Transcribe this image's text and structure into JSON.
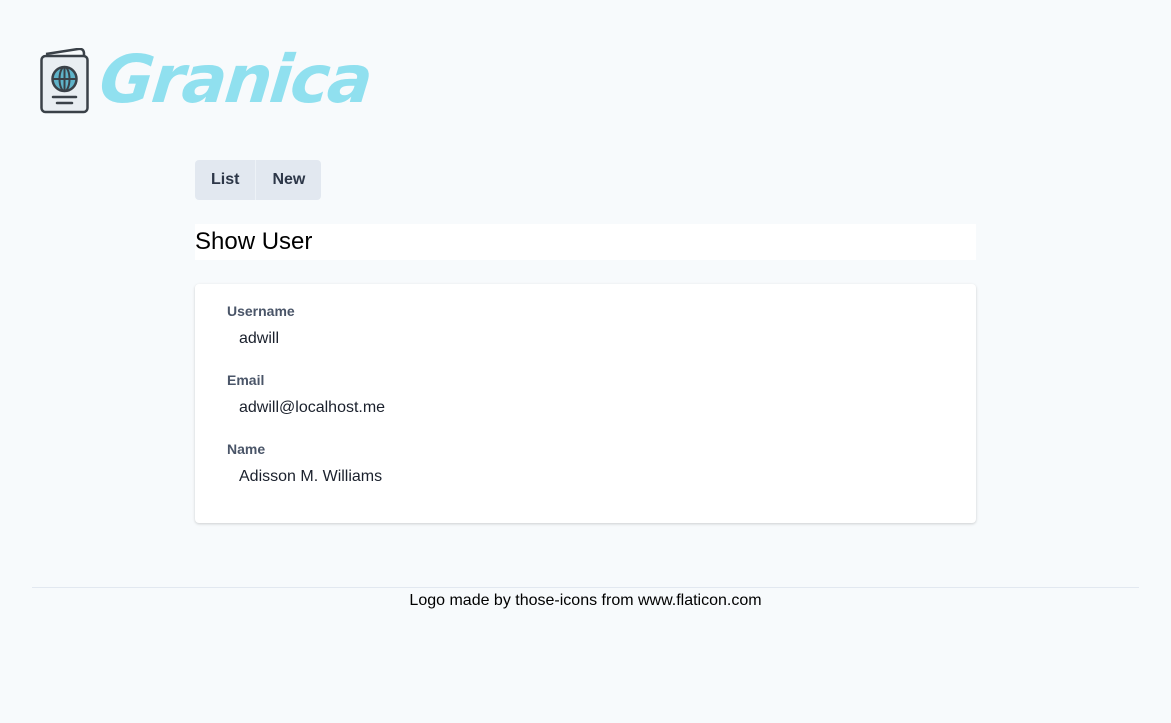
{
  "brand": {
    "name": "Granica",
    "color": "#90e0ef",
    "icon": "passport-icon"
  },
  "nav": {
    "tabs": [
      {
        "label": "List"
      },
      {
        "label": "New"
      }
    ]
  },
  "page": {
    "title": "Show User"
  },
  "user": {
    "fields": [
      {
        "label": "Username",
        "value": "adwill"
      },
      {
        "label": "Email",
        "value": "adwill@localhost.me"
      },
      {
        "label": "Name",
        "value": "Adisson M. Williams"
      }
    ]
  },
  "footer": {
    "credit": "Logo made by those-icons from www.flaticon.com"
  }
}
